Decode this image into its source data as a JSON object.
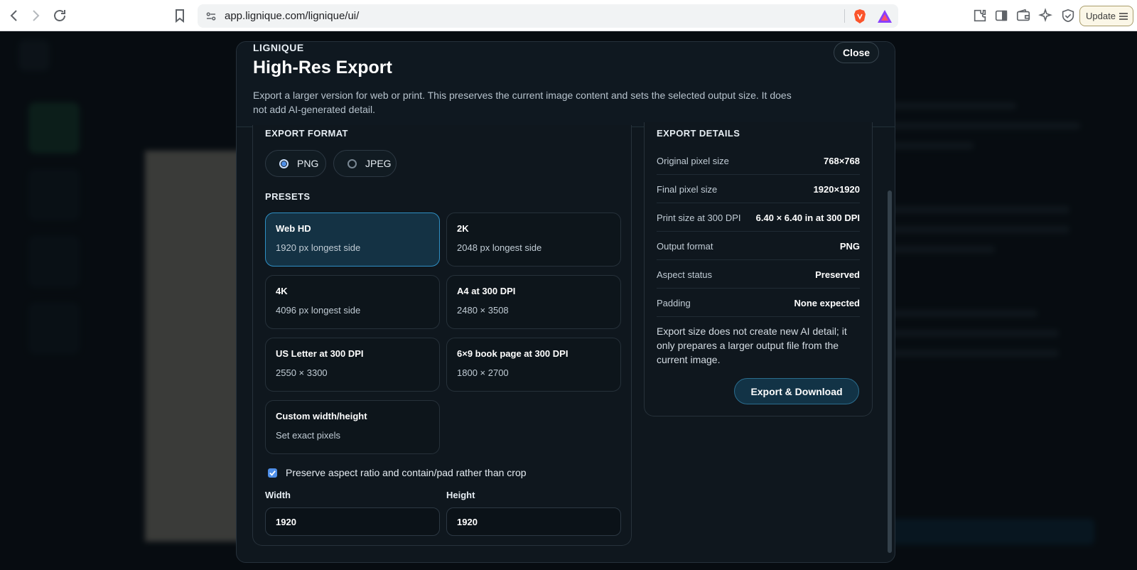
{
  "browser": {
    "url": "app.lignique.com/lignique/ui/",
    "update_label": "Update"
  },
  "modal": {
    "brand": "LIGNIQUE",
    "title": "High-Res Export",
    "description": "Export a larger version for web or print. This preserves the current image content and sets the selected output size. It does not add AI-generated detail.",
    "close_label": "Close"
  },
  "export_format": {
    "label": "EXPORT FORMAT",
    "options": [
      {
        "label": "PNG",
        "selected": true
      },
      {
        "label": "JPEG",
        "selected": false
      }
    ]
  },
  "presets": {
    "label": "PRESETS",
    "items": [
      {
        "name": "Web HD",
        "sub": "1920 px longest side",
        "selected": true
      },
      {
        "name": "2K",
        "sub": "2048 px longest side",
        "selected": false
      },
      {
        "name": "4K",
        "sub": "4096 px longest side",
        "selected": false
      },
      {
        "name": "A4 at 300 DPI",
        "sub": "2480 × 3508",
        "selected": false
      },
      {
        "name": "US Letter at 300 DPI",
        "sub": "2550 × 3300",
        "selected": false
      },
      {
        "name": "6×9 book page at 300 DPI",
        "sub": "1800 × 2700",
        "selected": false
      },
      {
        "name": "Custom width/height",
        "sub": "Set exact pixels",
        "selected": false
      }
    ]
  },
  "options": {
    "preserve_aspect_label": "Preserve aspect ratio and contain/pad rather than crop",
    "preserve_aspect_checked": true,
    "width_label": "Width",
    "width_value": "1920",
    "height_label": "Height",
    "height_value": "1920"
  },
  "details": {
    "label": "EXPORT DETAILS",
    "rows": [
      {
        "key": "Original pixel size",
        "value": "768×768"
      },
      {
        "key": "Final pixel size",
        "value": "1920×1920"
      },
      {
        "key": "Print size at 300 DPI",
        "value": "6.40 × 6.40 in at 300 DPI"
      },
      {
        "key": "Output format",
        "value": "PNG"
      },
      {
        "key": "Aspect status",
        "value": "Preserved"
      },
      {
        "key": "Padding",
        "value": "None expected"
      }
    ],
    "note": "Export size does not create new AI detail; it only prepares a larger output file from the current image.",
    "export_label": "Export & Download"
  },
  "colors": {
    "accent": "#4f8fe8",
    "selected_border": "#2f8fc4",
    "modal_bg": "#0f171e"
  }
}
